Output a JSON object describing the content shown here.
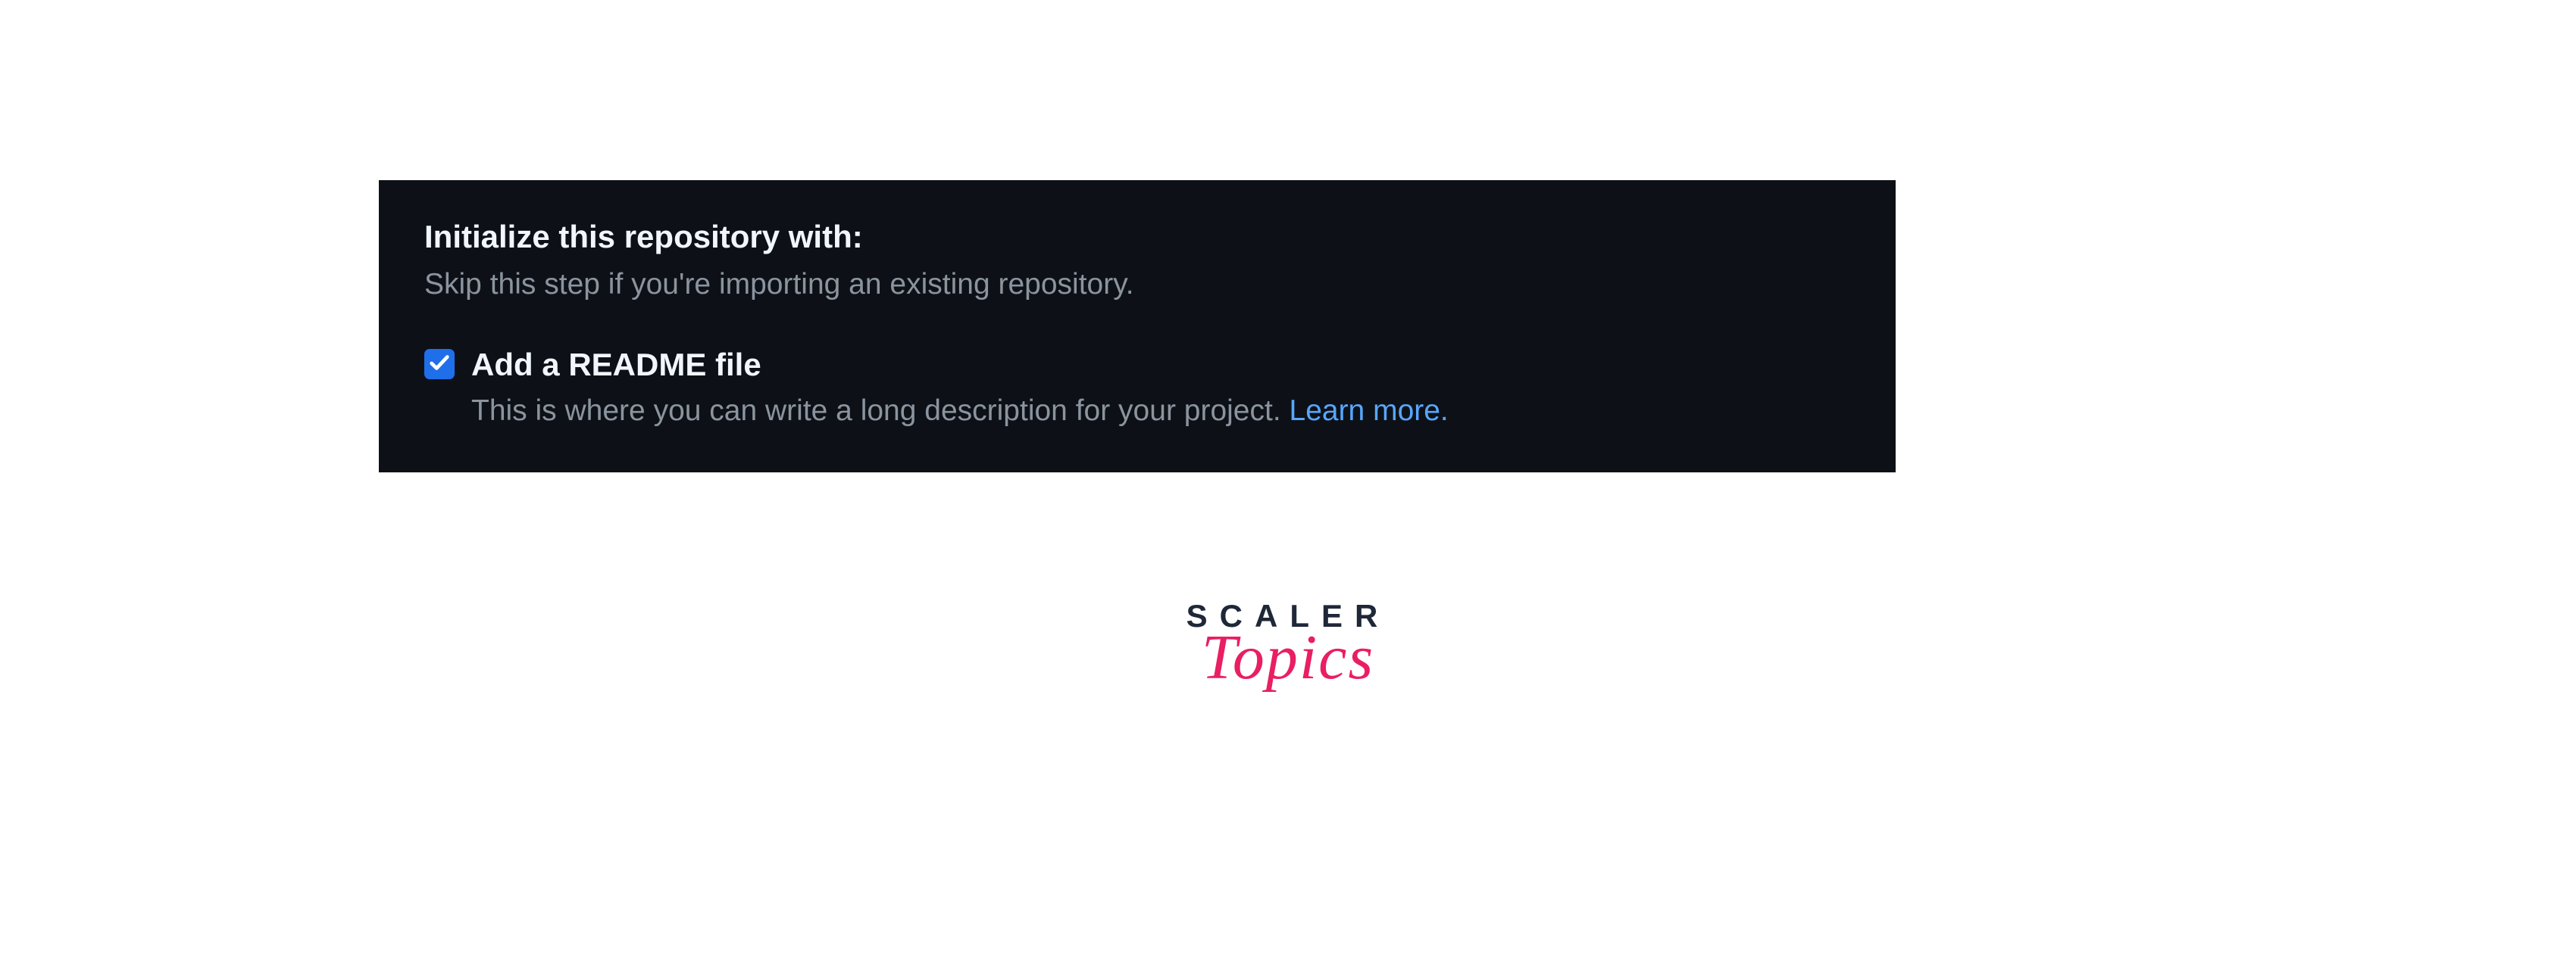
{
  "initialize": {
    "title": "Initialize this repository with:",
    "subtitle": "Skip this step if you're importing an existing repository.",
    "readme": {
      "label": "Add a README file",
      "description": "This is where you can write a long description for your project. ",
      "learn_more": "Learn more.",
      "checked": true
    }
  },
  "logo": {
    "line1": "SCALER",
    "line2": "Topics"
  }
}
